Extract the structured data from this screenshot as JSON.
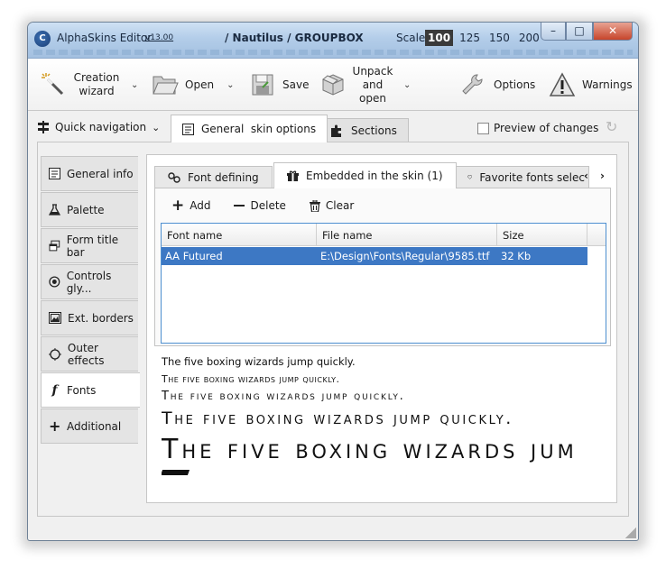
{
  "window": {
    "app_title": "AlphaSkins Editor",
    "version": "v13.00",
    "doc_title": "/ Nautilus / GROUPBOX",
    "scale_label": "Scale:",
    "scale_options": [
      "100",
      "125",
      "150",
      "200"
    ],
    "scale_selected": "100",
    "controls": {
      "minimize": "–",
      "maximize": "□",
      "close": "✕"
    }
  },
  "toolbar": {
    "creation_wizard": "Creation wizard",
    "open": "Open",
    "save": "Save",
    "unpack_open": "Unpack and open",
    "options": "Options",
    "warnings": "Warnings"
  },
  "nav": {
    "quick_navigation": "Quick navigation",
    "tab_general": "General  skin options",
    "tab_sections": "Sections",
    "preview": "Preview of changes"
  },
  "sidebar": {
    "items": [
      {
        "label": "General info",
        "icon": "document-icon"
      },
      {
        "label": "Palette",
        "icon": "flask-icon"
      },
      {
        "label": "Form title bar",
        "icon": "window-icon"
      },
      {
        "label": "Controls gly...",
        "icon": "radio-icon"
      },
      {
        "label": "Ext. borders",
        "icon": "image-frame-icon"
      },
      {
        "label": "Outer effects",
        "icon": "glow-icon"
      },
      {
        "label": "Fonts",
        "icon": "font-icon"
      },
      {
        "label": "Additional",
        "icon": "plus-icon"
      }
    ],
    "active": "Fonts"
  },
  "fonts": {
    "tabs": [
      "Font defining",
      "Embedded in the skin (1)",
      "Favorite fonts selec"
    ],
    "active_tab": "Embedded in the skin (1)",
    "actions": {
      "add": "Add",
      "delete": "Delete",
      "clear": "Clear"
    },
    "columns": [
      "Font name",
      "File name",
      "Size"
    ],
    "rows": [
      {
        "font_name": "AA Futured",
        "file_name": "E:\\Design\\Fonts\\Regular\\9585.ttf",
        "size": "32 Kb"
      }
    ],
    "sample_text": "The five boxing wizards jump quickly.",
    "sample_text_cut": "The five boxing wizards jum"
  }
}
